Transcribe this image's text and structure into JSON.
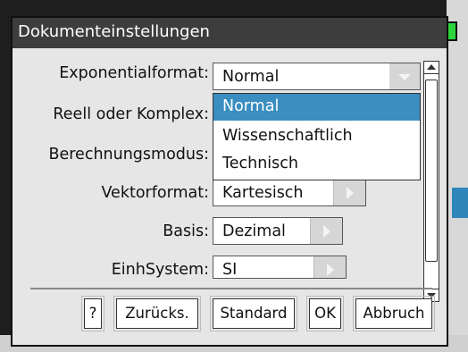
{
  "dialog": {
    "title": "Dokumenteinstellungen"
  },
  "fields": [
    {
      "label": "Exponentialformat:",
      "value": "Normal"
    },
    {
      "label": "Reell oder Komplex:",
      "value": ""
    },
    {
      "label": "Berechnungsmodus:",
      "value": ""
    },
    {
      "label": "Vektorformat:",
      "value": "Kartesisch"
    },
    {
      "label": "Basis:",
      "value": "Dezimal"
    },
    {
      "label": "EinhSystem:",
      "value": "SI"
    }
  ],
  "dropdown": {
    "options": [
      "Normal",
      "Wissenschaftlich",
      "Technisch"
    ],
    "highlighted": "Normal",
    "highlight_color": "#3a8ec0"
  },
  "buttons": {
    "help": "?",
    "back": "Zurücks.",
    "default": "Standard",
    "ok": "OK",
    "cancel": "Abbruch"
  }
}
